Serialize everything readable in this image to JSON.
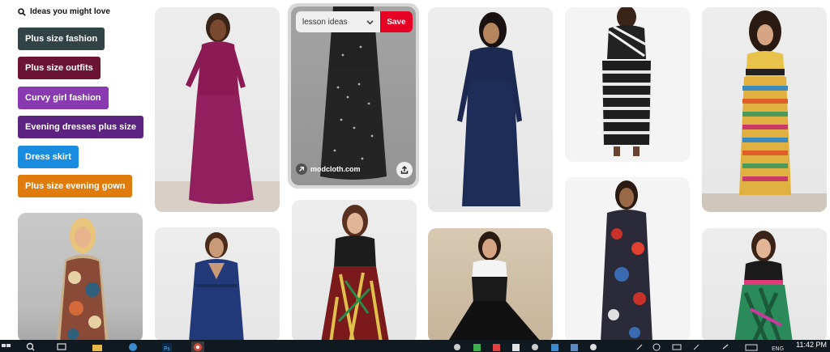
{
  "ideas": {
    "header": "Ideas you might love",
    "chips": [
      {
        "label": "Plus size fashion",
        "color": "#324346"
      },
      {
        "label": "Plus size outfits",
        "color": "#6b1434"
      },
      {
        "label": "Curvy girl fashion",
        "color": "#8a3ab0"
      },
      {
        "label": "Evening dresses plus size",
        "color": "#5c2480"
      },
      {
        "label": "Dress skirt",
        "color": "#1a8ce0"
      },
      {
        "label": "Plus size evening gown",
        "color": "#e07b0e"
      }
    ]
  },
  "hover_pin": {
    "board_select_label": "lesson ideas",
    "save_label": "Save",
    "source_label": "modcloth.com"
  },
  "taskbar": {
    "time": "11:42 PM"
  },
  "colors": {
    "save_red": "#e60023",
    "taskbar": "#101820"
  }
}
